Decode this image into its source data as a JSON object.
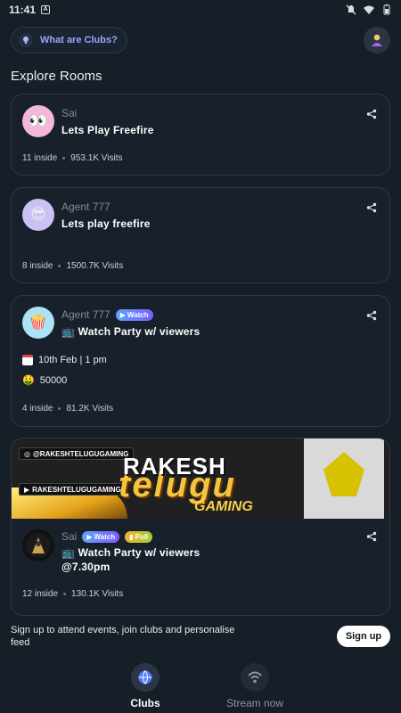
{
  "status_bar": {
    "time": "11:41",
    "app_glyph": "A"
  },
  "header": {
    "clubs_pill_label": "What are Clubs?"
  },
  "section_title": "Explore Rooms",
  "rooms": [
    {
      "host": "Sai",
      "title": "Lets Play Freefire",
      "inside": "11 inside",
      "visits": "953.1K Visits",
      "avatar_emoji": "👀",
      "avatar_bg": "#f4b7d8"
    },
    {
      "host": "Agent 777",
      "title": "Lets play freefire",
      "inside": "8 inside",
      "visits": "1500.7K Visits",
      "avatar_emoji": "😎",
      "avatar_bg": "#c9c2f2"
    },
    {
      "host": "Agent 777",
      "badge": "Watch",
      "title": "📺 Watch Party w/ viewers",
      "event_date": "10th Feb | 1 pm",
      "prize": "50000",
      "inside": "4 inside",
      "visits": "81.2K Visits",
      "avatar_emoji": "🍿",
      "avatar_bg": "#a9e3f5"
    },
    {
      "host": "Sai",
      "badges": [
        "Watch",
        "Poll"
      ],
      "title_line1": "📺 Watch Party w/ viewers",
      "title_line2": "@7.30pm",
      "inside": "12 inside",
      "visits": "130.1K Visits",
      "banner": {
        "handle_instagram": "@RAKESHTELUGUGAMING",
        "handle_youtube": "RAKESHTELUGUGAMING",
        "name": "RAKESH",
        "telugu": "telugu",
        "gaming": "GAMING"
      }
    }
  ],
  "signup": {
    "text": "Sign up to attend events, join clubs and personalise feed",
    "button": "Sign up"
  },
  "bottom_nav": [
    {
      "label": "Clubs",
      "active": true
    },
    {
      "label": "Stream now",
      "active": false
    }
  ],
  "colors": {
    "background": "#161e27",
    "card_border": "#2c3a48",
    "accent": "#9aa6ff"
  }
}
